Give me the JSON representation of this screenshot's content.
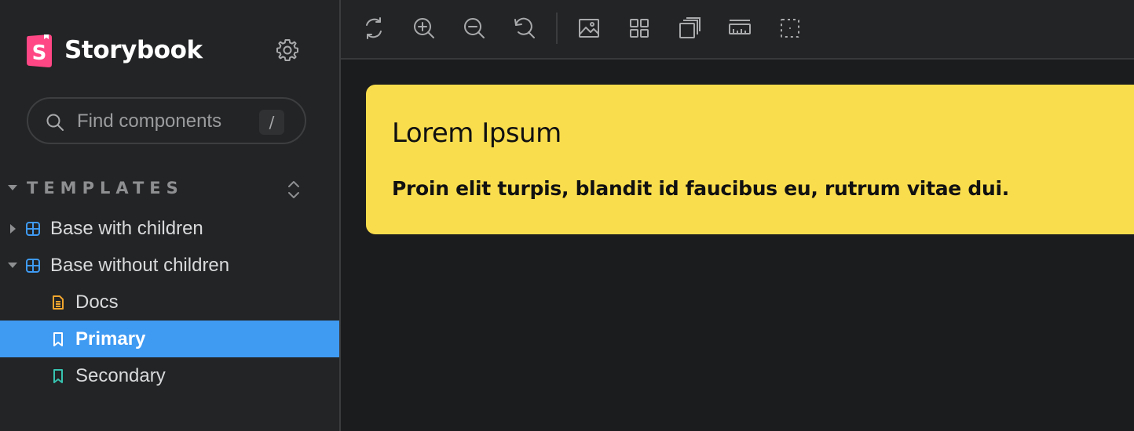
{
  "app": {
    "brand_name": "Storybook",
    "accent_color": "#3f9af2",
    "logo_color": "#ff4785"
  },
  "sidebar": {
    "search": {
      "placeholder": "Find components",
      "value": "",
      "shortcut": "/"
    },
    "section": {
      "label": "TEMPLATES"
    },
    "items": [
      {
        "label": "Base with children",
        "icon": "component-icon",
        "expanded": false
      },
      {
        "label": "Base without children",
        "icon": "component-icon",
        "expanded": true
      },
      {
        "label": "Docs",
        "icon": "document-icon"
      },
      {
        "label": "Primary",
        "icon": "bookmark-icon",
        "selected": true
      },
      {
        "label": "Secondary",
        "icon": "bookmark-icon"
      }
    ]
  },
  "toolbar": {
    "buttons": [
      {
        "name": "remount-icon"
      },
      {
        "name": "zoom-in-icon"
      },
      {
        "name": "zoom-out-icon"
      },
      {
        "name": "zoom-reset-icon"
      },
      {
        "name": "background-icon"
      },
      {
        "name": "grid-icon"
      },
      {
        "name": "viewport-icon"
      },
      {
        "name": "measure-icon"
      },
      {
        "name": "outline-icon"
      }
    ]
  },
  "preview": {
    "title": "Lorem Ipsum",
    "text": "Proin elit turpis, blandit id faucibus eu, rutrum vitae dui.",
    "card_color": "#fadd4d"
  }
}
